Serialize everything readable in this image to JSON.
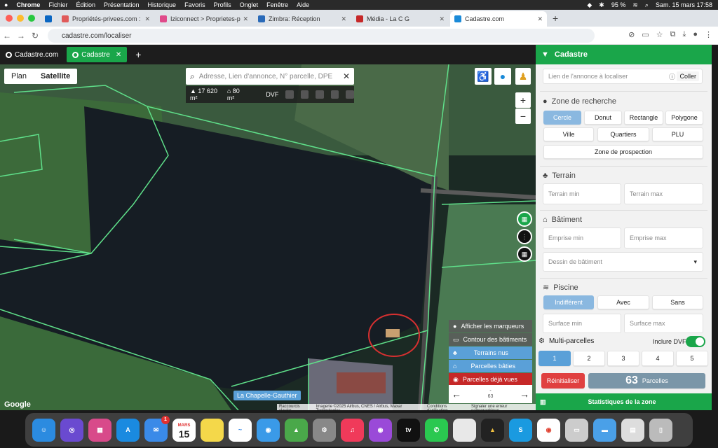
{
  "menubar": {
    "app": "Chrome",
    "items": [
      "Fichier",
      "Édition",
      "Présentation",
      "Historique",
      "Favoris",
      "Profils",
      "Onglet",
      "Fenêtre",
      "Aide"
    ],
    "battery": "95 %",
    "datetime": "Sam. 15 mars 17:58"
  },
  "browser_tabs": [
    {
      "title": "Propriétés-privees.com : Esp",
      "color": "#e05a5a"
    },
    {
      "title": "Iziconnect > Proprietes-prive",
      "color": "#e04a8a"
    },
    {
      "title": "Zimbra: Réception",
      "color": "#2a6ab8"
    },
    {
      "title": "Média - La C G",
      "color": "#c62828"
    },
    {
      "title": "Cadastre.com",
      "color": "#1a8ad8"
    }
  ],
  "url": "cadastre.com/localiser",
  "app_tabs": {
    "tab1": "Cadastre.com",
    "tab2": "Cadastre"
  },
  "map": {
    "toggle": {
      "plan": "Plan",
      "satellite": "Satellite"
    },
    "search_placeholder": "Adresse, Lien d'annonce, N° parcelle, DPE",
    "area_land": "17 620 m²",
    "area_building": "80 m²",
    "dvf": "DVF",
    "place_label": "La Chapelle-Gauthier",
    "google": "Google",
    "attribution": [
      "Raccourcis clavier",
      "Imagerie ©2025 Airbus, CNES / Airbus, Maxar Technologies",
      "Conditions d'utilisation",
      "Signaler une erreur cartographique"
    ],
    "layers": [
      "Afficher les marqueurs",
      "Contour des bâtiments",
      "Terrains nus",
      "Parcelles bâties",
      "Parcelles déjà vues"
    ],
    "pager": {
      "dash": "-",
      "count": "63"
    }
  },
  "sidebar": {
    "title": "Cadastre",
    "link_placeholder": "Lien de l'annonce à localiser",
    "paste": "Coller",
    "zone_title": "Zone de recherche",
    "zone_chips": [
      "Cercle",
      "Donut",
      "Rectangle",
      "Polygone",
      "Ville",
      "Quartiers",
      "PLU"
    ],
    "prospection": "Zone de prospection",
    "terrain_title": "Terrain",
    "terrain_min": "Terrain min",
    "terrain_max": "Terrain max",
    "batiment_title": "Bâtiment",
    "emprise_min": "Emprise min",
    "emprise_max": "Emprise max",
    "dessin": "Dessin de bâtiment",
    "piscine_title": "Piscine",
    "piscine_chips": [
      "Indifférent",
      "Avec",
      "Sans"
    ],
    "surface_min": "Surface min",
    "surface_max": "Surface max",
    "multi": "Multi-parcelles",
    "dvf": "Inclure DVF",
    "numbers": [
      "1",
      "2",
      "3",
      "4",
      "5"
    ],
    "reset": "Réinitialiser",
    "count": "63",
    "count_label": "Parcelles",
    "stats": "Statistiques de la zone"
  },
  "dock": {
    "calendar_month": "MARS",
    "calendar_day": "15",
    "mail_badge": "1"
  }
}
